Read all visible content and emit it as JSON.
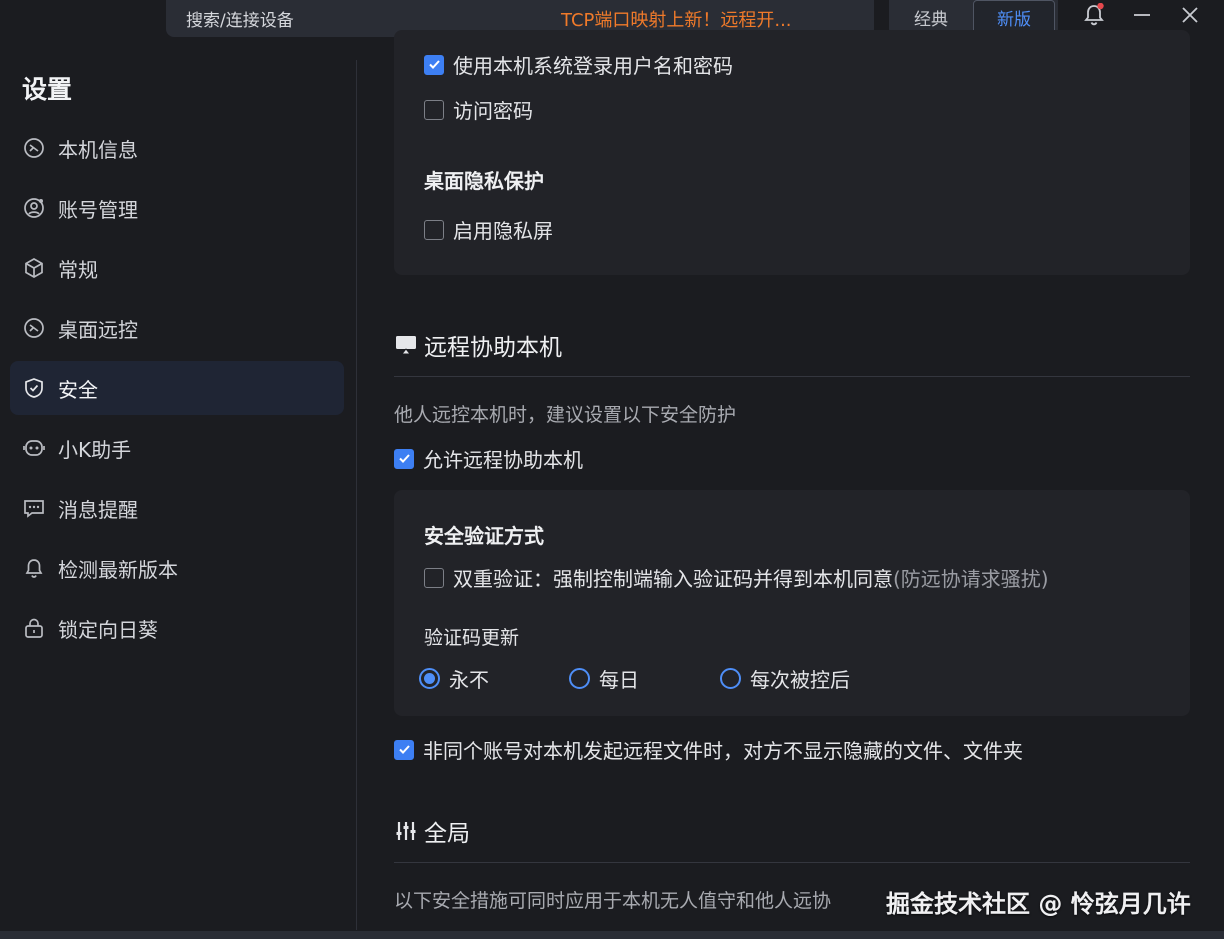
{
  "topbar": {
    "search_placeholder": "搜索/连接设备",
    "promo_text": "TCP端口映射上新！远程开...",
    "version_classic": "经典",
    "version_new": "新版",
    "notification_dot_color": "#e5484d"
  },
  "sidebar": {
    "title": "设置",
    "items": [
      {
        "label": "本机信息",
        "icon": "monitor-remote-icon"
      },
      {
        "label": "账号管理",
        "icon": "user-gear-icon"
      },
      {
        "label": "常规",
        "icon": "cube-icon"
      },
      {
        "label": "桌面远控",
        "icon": "monitor-remote-icon"
      },
      {
        "label": "安全",
        "icon": "shield-icon",
        "active": true
      },
      {
        "label": "小K助手",
        "icon": "robot-icon"
      },
      {
        "label": "消息提醒",
        "icon": "message-icon"
      },
      {
        "label": "检测最新版本",
        "icon": "bell-update-icon"
      },
      {
        "label": "锁定向日葵",
        "icon": "lock-icon"
      }
    ]
  },
  "main": {
    "login_panel": {
      "use_system_login_label": "使用本机系统登录用户名和密码",
      "use_system_login_checked": true,
      "access_password_label": "访问密码",
      "access_password_checked": false,
      "privacy_heading": "桌面隐私保护",
      "privacy_screen_label": "启用隐私屏",
      "privacy_screen_checked": false
    },
    "remote_assist": {
      "title": "远程协助本机",
      "description": "他人远控本机时，建议设置以下安全防护",
      "allow_label": "允许远程协助本机",
      "allow_checked": true,
      "verify_heading": "安全验证方式",
      "dual_verify_label": "双重验证：强制控制端输入验证码并得到本机同意",
      "dual_verify_hint": "(防远协请求骚扰)",
      "dual_verify_checked": false,
      "code_refresh_label": "验证码更新",
      "code_refresh_options": [
        "永不",
        "每日",
        "每次被控后"
      ],
      "code_refresh_selected": "永不",
      "hide_files_label": "非同个账号对本机发起远程文件时，对方不显示隐藏的文件、文件夹",
      "hide_files_checked": true
    },
    "global": {
      "title": "全局",
      "description": "以下安全措施可同时应用于本机无人值守和他人远协"
    }
  },
  "watermark": "掘金技术社区 @ 怜弦月几许",
  "colors": {
    "accent": "#3d7ff3",
    "promo": "#f07a2a",
    "background": "#1b1c20",
    "panel": "#222328"
  }
}
